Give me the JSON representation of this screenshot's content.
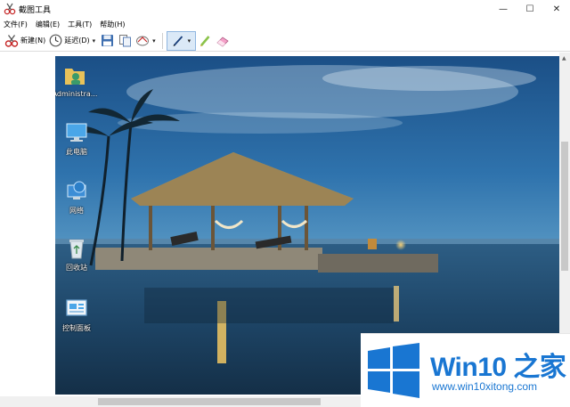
{
  "window": {
    "title": "截图工具",
    "minimize_glyph": "—",
    "maximize_glyph": "☐",
    "close_glyph": "✕"
  },
  "menu": {
    "items": [
      "文件(F)",
      "编辑(E)",
      "工具(T)",
      "帮助(H)"
    ]
  },
  "toolbar": {
    "new_label": "新建(N)",
    "delay_label": "延迟(D)",
    "dropdown_glyph": "▾"
  },
  "desktop_icons": [
    {
      "label": "Administra...",
      "icon": "user-folder-icon"
    },
    {
      "label": "此电脑",
      "icon": "computer-icon"
    },
    {
      "label": "网络",
      "icon": "network-icon"
    },
    {
      "label": "回收站",
      "icon": "recycle-bin-icon"
    },
    {
      "label": "控制面板",
      "icon": "control-panel-icon"
    }
  ],
  "watermark": {
    "title": "Win10 之家",
    "url": "www.win10xitong.com"
  },
  "colors": {
    "accent": "#1976d2",
    "pen_group_bg": "#dbe9f7"
  }
}
